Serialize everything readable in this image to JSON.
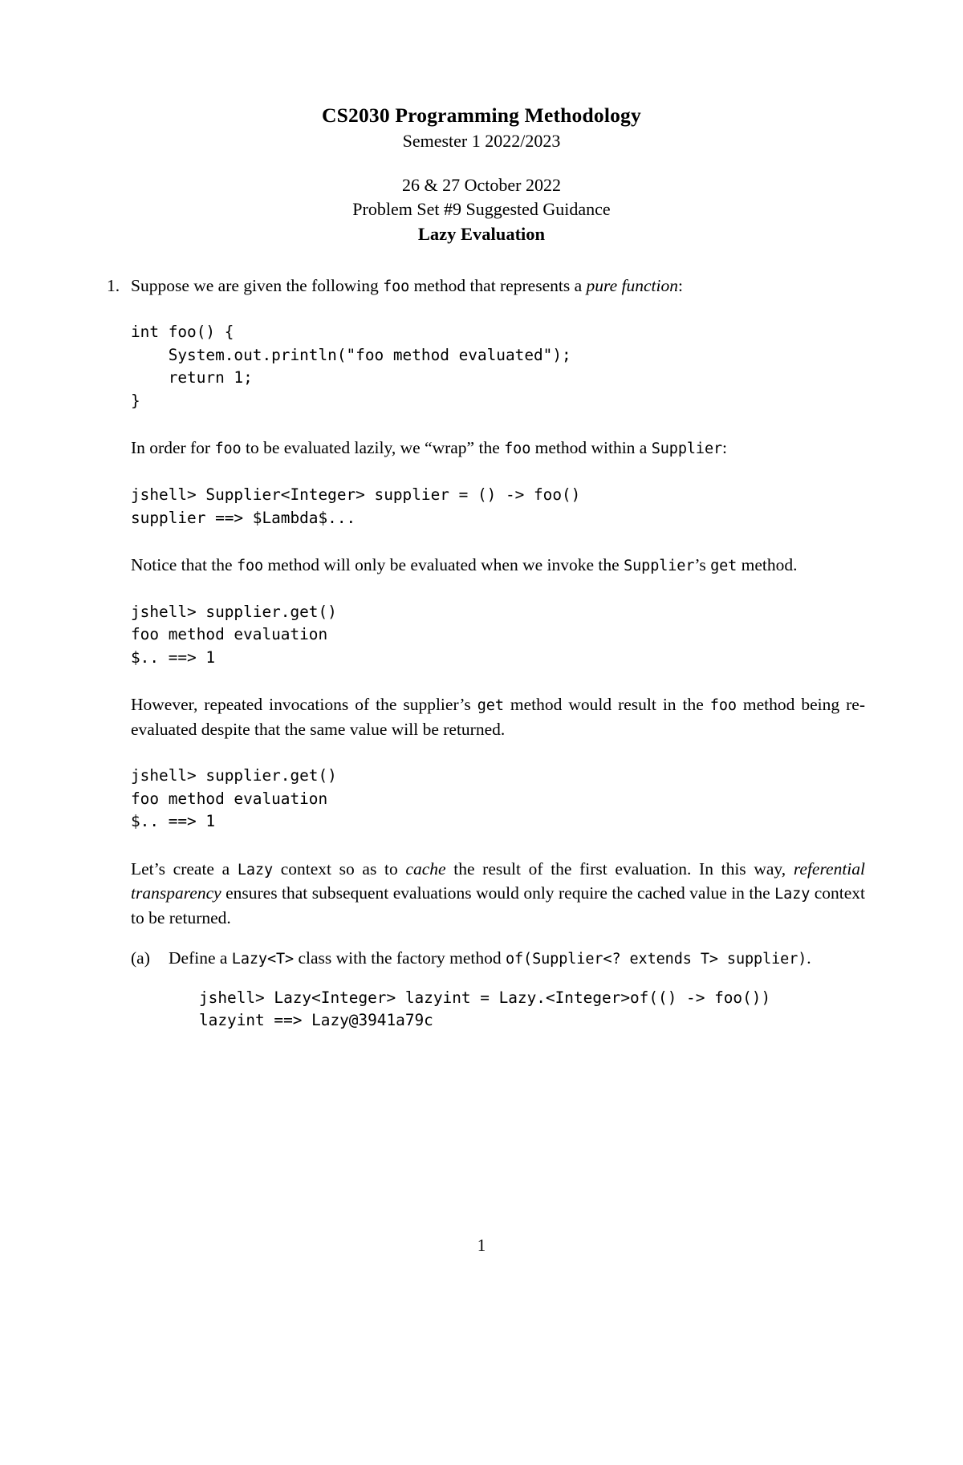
{
  "document": {
    "title": "CS2030 Programming Methodology",
    "subtitle": "Semester 1 2022/2023",
    "date": "26 & 27 October 2022",
    "set_line": "Problem Set #9 Suggested Guidance",
    "topic": "Lazy Evaluation",
    "page_number": "1"
  },
  "item1": {
    "number": "1.",
    "intro_a": "Suppose we are given the following ",
    "intro_code": "foo",
    "intro_b": " method that represents a ",
    "intro_italic": "pure function",
    "intro_c": ":",
    "code_foo": "int foo() {\n    System.out.println(\"foo method evaluated\");\n    return 1;\n}",
    "para_wrap_a": "In order for ",
    "para_wrap_code1": "foo",
    "para_wrap_b": " to be evaluated lazily, we “wrap” the ",
    "para_wrap_code2": "foo",
    "para_wrap_c": " method within a ",
    "para_wrap_code3": "Supplier",
    "para_wrap_d": ":",
    "code_supplier": "jshell> Supplier<Integer> supplier = () -> foo()\nsupplier ==> $Lambda$...",
    "para_notice_a": "Notice that the ",
    "para_notice_code1": "foo",
    "para_notice_b": " method will only be evaluated when we invoke the ",
    "para_notice_code2": "Supplier",
    "para_notice_c": "’s ",
    "para_notice_code3": "get",
    "para_notice_d": " method.",
    "code_get1": "jshell> supplier.get()\nfoo method evaluation\n$.. ==> 1",
    "para_however_a": "However, repeated invocations of the supplier’s ",
    "para_however_code1": "get",
    "para_however_b": " method would result in the ",
    "para_however_code2": "foo",
    "para_however_c": " method being re-evaluated despite that the same value will be returned.",
    "code_get2": "jshell> supplier.get()\nfoo method evaluation\n$.. ==> 1",
    "para_lazy_a": "Let’s create a ",
    "para_lazy_code1": "Lazy",
    "para_lazy_b": " context so as to ",
    "para_lazy_italic1": "cache",
    "para_lazy_c": " the result of the first evaluation.  In this way, ",
    "para_lazy_italic2": "referential transparency",
    "para_lazy_d": " ensures that subsequent evaluations would only require the cached value in the ",
    "para_lazy_code2": "Lazy",
    "para_lazy_e": " context to be returned."
  },
  "item1a": {
    "label": "(a)",
    "text_a": "Define a ",
    "code1": "Lazy<T>",
    "text_b": " class with the factory method ",
    "code2": "of(Supplier<? extends T> supplier)",
    "text_c": ".",
    "code_block": "jshell> Lazy<Integer> lazyint = Lazy.<Integer>of(() -> foo())\nlazyint ==> Lazy@3941a79c"
  }
}
